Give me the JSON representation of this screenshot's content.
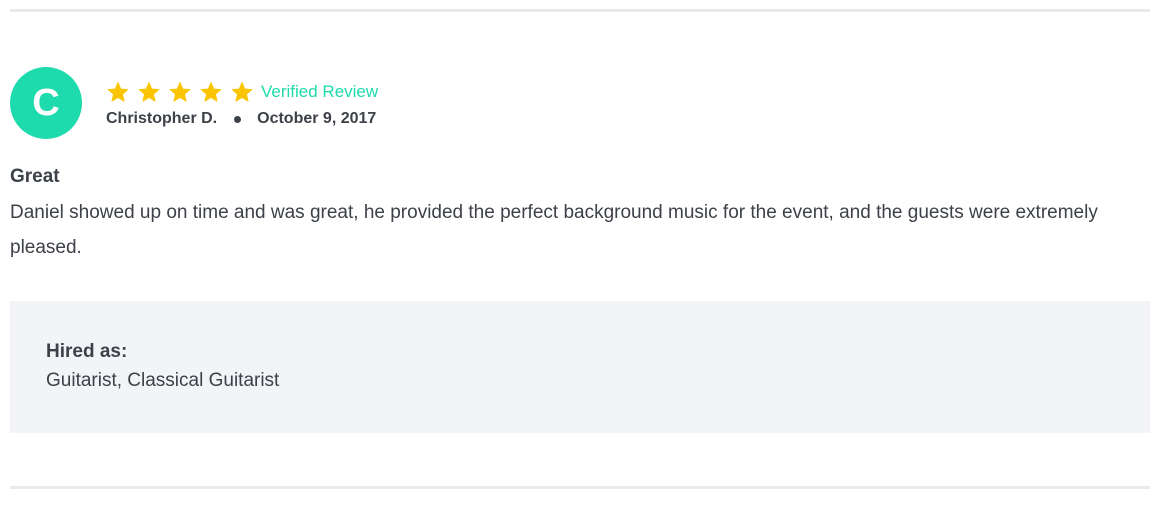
{
  "review": {
    "avatar_initial": "C",
    "rating": 5,
    "max_rating": 5,
    "verified_label": "Verified Review",
    "author": "Christopher D.",
    "date": "October 9, 2017",
    "title": "Great",
    "body": "Daniel showed up on time and was great, he provided the perfect background music for the event, and the guests were extremely pleased.",
    "hired_label": "Hired as:",
    "hired_value": "Guitarist, Classical Guitarist"
  },
  "colors": {
    "accent": "#1ddbac",
    "star": "#fbc400",
    "text": "#3d4148",
    "panel": "#f3f4f7",
    "divider": "#e9eaec"
  },
  "icons": {
    "star": "star-icon",
    "separator": "dot-separator"
  }
}
